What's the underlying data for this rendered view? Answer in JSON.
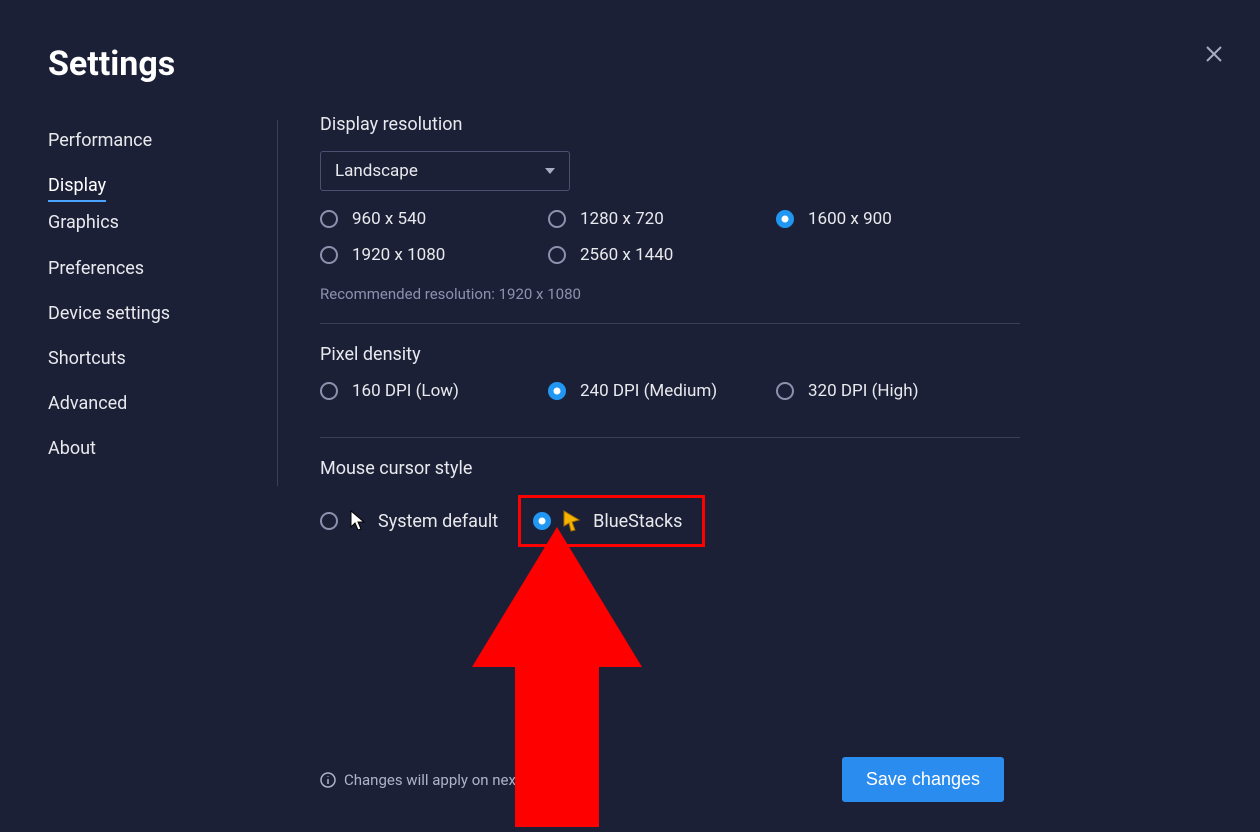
{
  "title": "Settings",
  "sidebar": {
    "items": [
      "Performance",
      "Display",
      "Graphics",
      "Preferences",
      "Device settings",
      "Shortcuts",
      "Advanced",
      "About"
    ],
    "active_index": 1
  },
  "resolution": {
    "heading": "Display resolution",
    "orientation": "Landscape",
    "options": [
      "960 x 540",
      "1280 x 720",
      "1600 x 900",
      "1920 x 1080",
      "2560 x 1440"
    ],
    "selected_index": 2,
    "recommended": "Recommended resolution: 1920 x 1080"
  },
  "density": {
    "heading": "Pixel density",
    "options": [
      "160 DPI (Low)",
      "240 DPI (Medium)",
      "320 DPI (High)"
    ],
    "selected_index": 1
  },
  "cursor": {
    "heading": "Mouse cursor style",
    "options": [
      "System default",
      "BlueStacks"
    ],
    "selected_index": 1
  },
  "footer": {
    "note": "Changes will apply on nex",
    "save": "Save changes"
  }
}
